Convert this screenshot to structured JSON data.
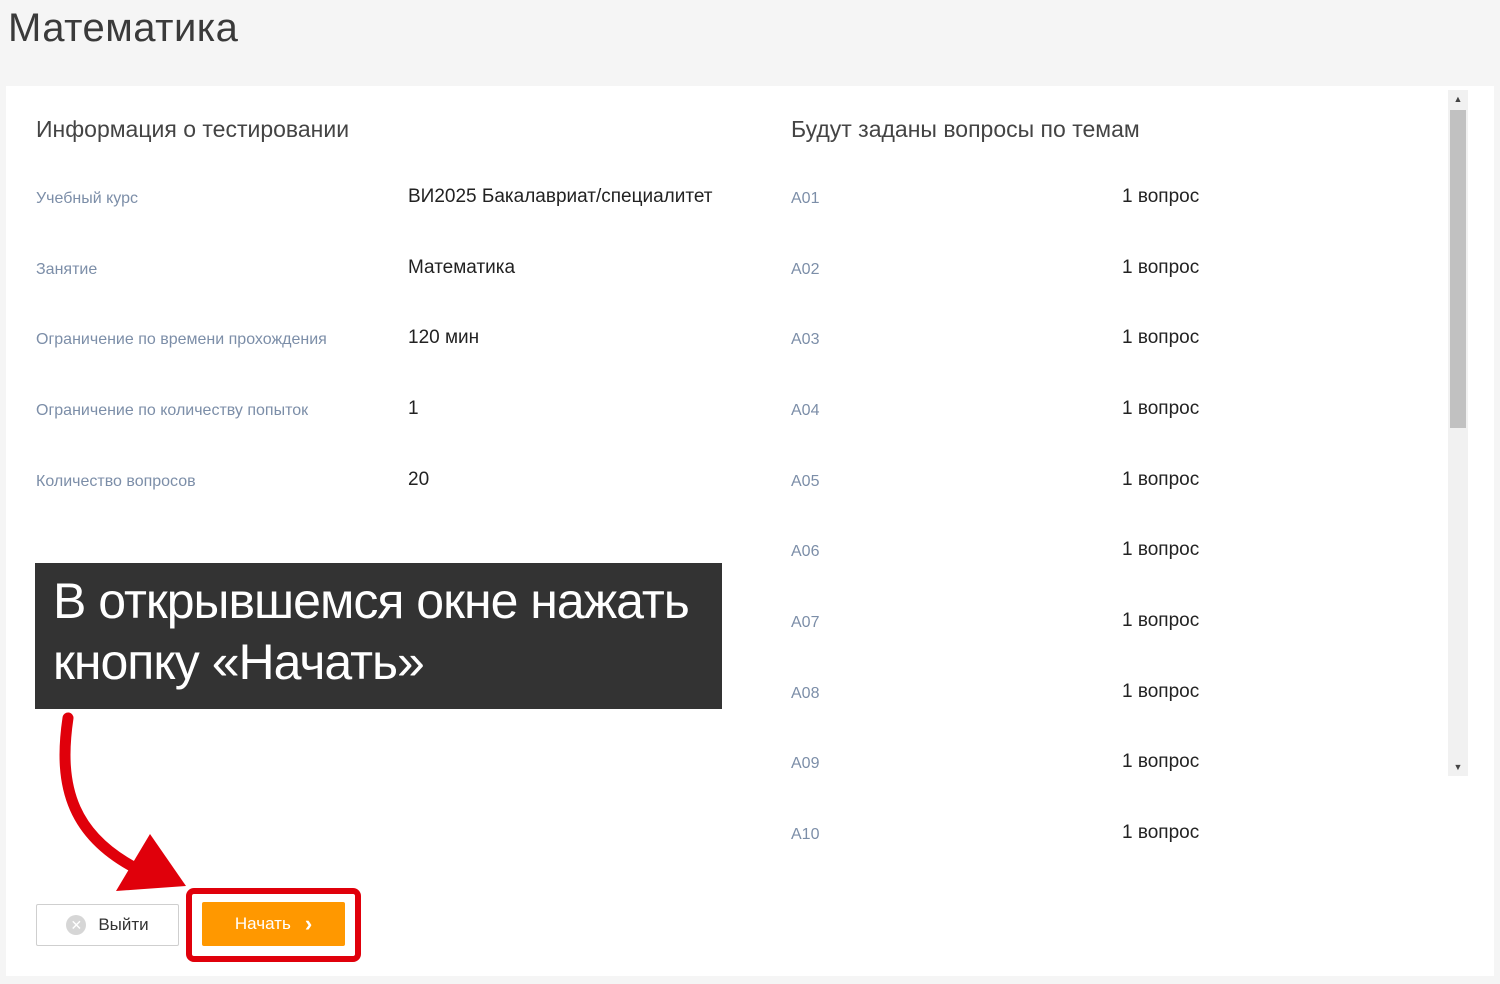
{
  "page": {
    "title": "Математика"
  },
  "info": {
    "heading": "Информация о тестировании",
    "rows": [
      {
        "label": "Учебный курс",
        "value": "ВИ2025 Бакалавриат/специалитет"
      },
      {
        "label": "Занятие",
        "value": "Математика"
      },
      {
        "label": "Ограничение по времени прохождения",
        "value": "120 мин"
      },
      {
        "label": "Ограничение по количеству попыток",
        "value": "1"
      },
      {
        "label": "Количество вопросов",
        "value": "20"
      }
    ]
  },
  "topics": {
    "heading": "Будут заданы вопросы по темам",
    "items": [
      {
        "name": "A01",
        "count": "1 вопрос"
      },
      {
        "name": "A02",
        "count": "1 вопрос"
      },
      {
        "name": "A03",
        "count": "1 вопрос"
      },
      {
        "name": "A04",
        "count": "1 вопрос"
      },
      {
        "name": "A05",
        "count": "1 вопрос"
      },
      {
        "name": "A06",
        "count": "1 вопрос"
      },
      {
        "name": "A07",
        "count": "1 вопрос"
      },
      {
        "name": "A08",
        "count": "1 вопрос"
      },
      {
        "name": "A09",
        "count": "1 вопрос"
      },
      {
        "name": "A10",
        "count": "1 вопрос"
      }
    ]
  },
  "callout": {
    "line1": "В открывшемся окне нажать",
    "line2": "кнопку «Начать»"
  },
  "buttons": {
    "exit_label": "Выйти",
    "start_label": "Начать"
  },
  "colors": {
    "accent": "#ff9800",
    "highlight": "#e0000b",
    "callout_bg": "#333333",
    "label": "#7c8ea8"
  }
}
